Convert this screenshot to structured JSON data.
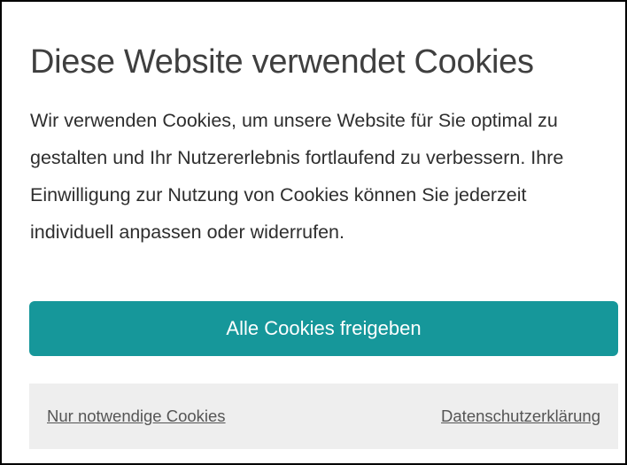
{
  "dialog": {
    "title": "Diese Website verwendet Cookies",
    "message": "Wir verwenden Cookies, um unsere Website für Sie optimal zu gestalten und Ihr Nutzererlebnis fortlaufend zu verbessern. Ihre Einwilligung zur Nutzung von Cookies können Sie jederzeit individuell anpassen oder widerrufen.",
    "accept_all_label": "Alle Cookies freigeben",
    "necessary_only_label": "Nur notwendige Cookies",
    "privacy_label": "Datenschutzerklärung"
  },
  "colors": {
    "accent": "#16979a",
    "footer_background": "#eeeeee",
    "border": "#000000"
  }
}
